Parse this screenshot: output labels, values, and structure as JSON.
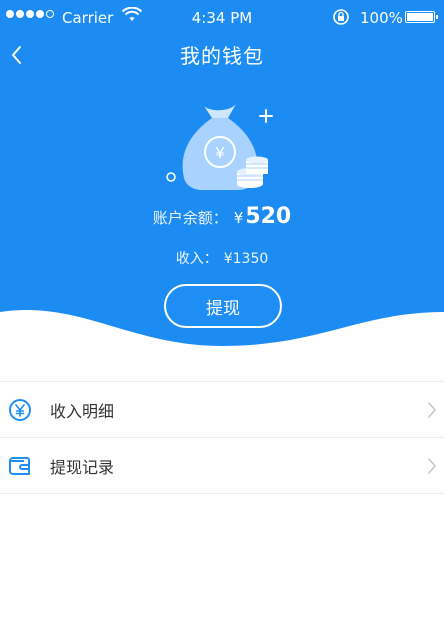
{
  "status_bar": {
    "carrier": "Carrier",
    "time": "4:34 PM",
    "battery": "100%"
  },
  "nav": {
    "title": "我的钱包",
    "back_icon": "chevron-left-icon"
  },
  "wallet": {
    "balance_label": "账户余额：",
    "balance_currency": "¥",
    "balance_amount": "520",
    "income_label": "收入：",
    "income_value": "¥1350",
    "illustration_symbol": "¥",
    "withdraw_label": "提现"
  },
  "list": {
    "items": [
      {
        "label": "收入明细",
        "icon": "yuan-circle-icon"
      },
      {
        "label": "提现记录",
        "icon": "wallet-icon"
      }
    ]
  },
  "colors": {
    "primary_blue": "#1c8cf3",
    "divider": "#ececec",
    "icon_blue": "#1f8ef5"
  }
}
